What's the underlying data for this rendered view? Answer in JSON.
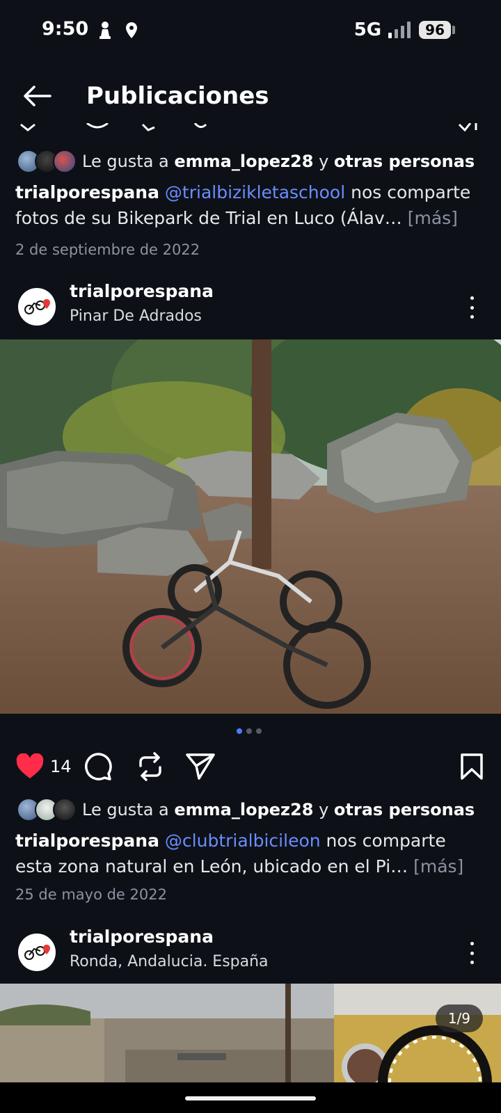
{
  "status": {
    "time": "9:50",
    "network": "5G",
    "battery": "96"
  },
  "header": {
    "title": "Publicaciones",
    "back_icon": "arrow-left-icon"
  },
  "posts": [
    {
      "liked_by_prefix": "Le gusta a",
      "liked_by_user": "emma_lopez28",
      "liked_by_joiner": "y",
      "liked_by_others": "otras personas",
      "caption_user": "trialporespana",
      "caption_mention": "@trialbizikletaschool",
      "caption_text": " nos comparte fotos de su Bikepark de Trial en Luco (Álav…",
      "more_label": "[más]",
      "date": "2 de septiembre de 2022"
    },
    {
      "username": "trialporespana",
      "location": "Pinar De Adrados",
      "likes": "14",
      "liked_by_prefix": "Le gusta a",
      "liked_by_user": "emma_lopez28",
      "liked_by_joiner": "y",
      "liked_by_others": "otras personas",
      "caption_user": "trialporespana",
      "caption_mention": "@clubtrialbicileon",
      "caption_text": " nos comparte esta zona natural en León, ubicado en el Pi…",
      "more_label": "[más]",
      "date": "25 de mayo de 2022",
      "carousel": {
        "active": 1,
        "total": 3
      }
    },
    {
      "username": "trialporespana",
      "location": "Ronda, Andalucia. España",
      "image_counter": "1/9"
    }
  ],
  "icons": {
    "like": "heart-filled-icon",
    "comment": "comment-bubble-icon",
    "repost": "repost-icon",
    "share": "send-icon",
    "save": "bookmark-icon",
    "menu": "more-vertical-icon"
  },
  "colors": {
    "background": "#0d1117",
    "mention": "#6b8cff",
    "like": "#ff2d4a",
    "dot_active": "#4a7dff"
  }
}
